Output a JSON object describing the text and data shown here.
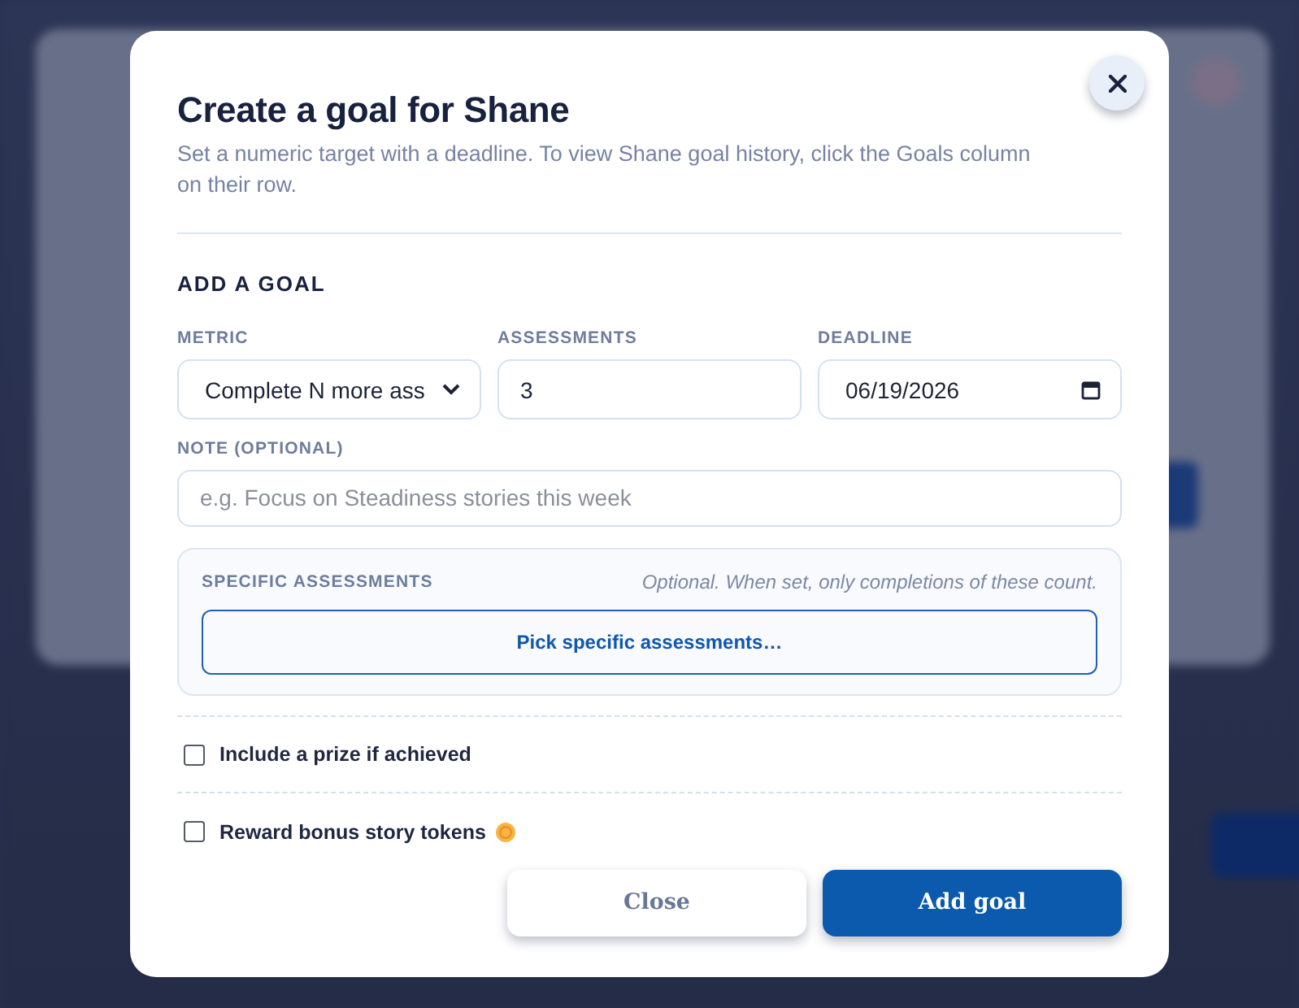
{
  "dialog": {
    "title": "Create a goal for Shane",
    "description": "Set a numeric target with a deadline. To view Shane goal history, click the Goals column on their row."
  },
  "section_title": "ADD A GOAL",
  "fields": [
    {
      "label": "METRIC",
      "kind": "select",
      "value": "Complete N more ass"
    },
    {
      "label": "ASSESSMENTS",
      "kind": "number",
      "value": "3"
    },
    {
      "label": "DEADLINE",
      "kind": "date",
      "value": "06/19/2026"
    }
  ],
  "note": {
    "label": "NOTE (OPTIONAL)",
    "placeholder": "e.g. Focus on Steadiness stories this week"
  },
  "specific_assessments": {
    "title": "SPECIFIC ASSESSMENTS",
    "hint": "Optional. When set, only completions of these count.",
    "button": "Pick specific assessments…"
  },
  "options": [
    {
      "label": "Include a prize if achieved",
      "checked": false,
      "kind": "plain"
    },
    {
      "label": "Reward bonus story tokens",
      "checked": false,
      "kind": "token"
    }
  ],
  "buttons": [
    {
      "label": "Close",
      "kind": "secondary"
    },
    {
      "label": "Add goal",
      "kind": "primary"
    }
  ]
}
